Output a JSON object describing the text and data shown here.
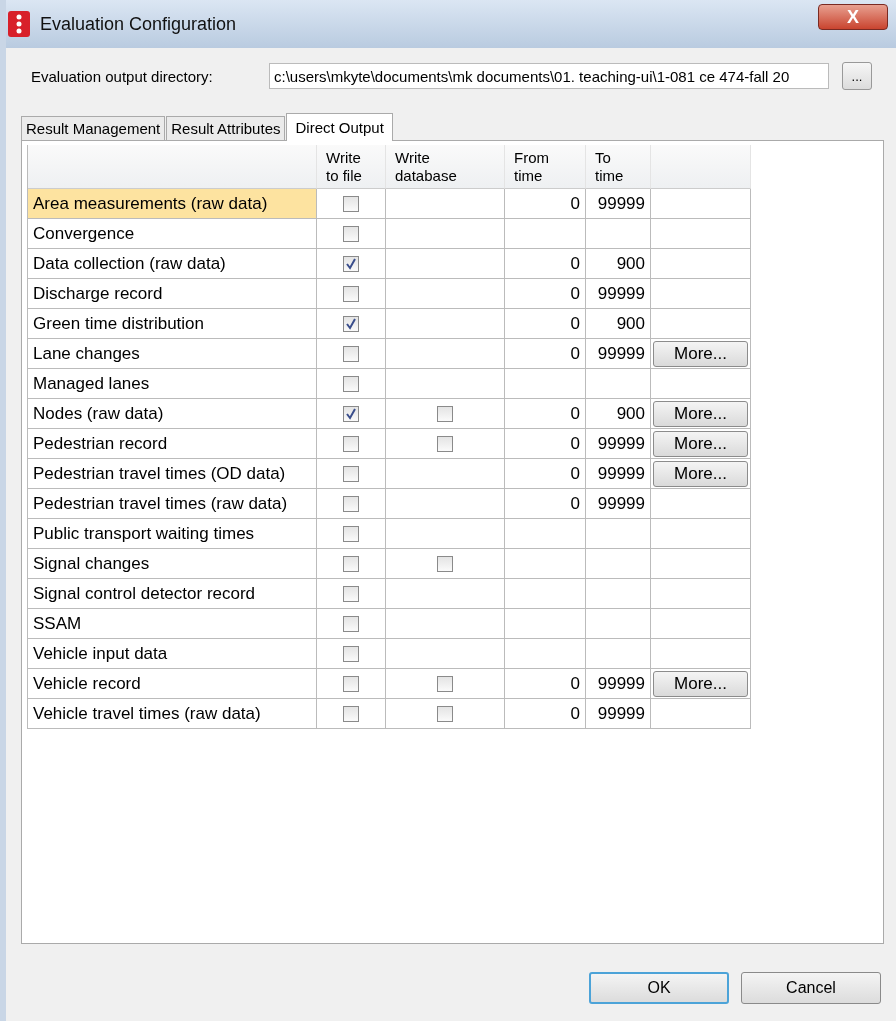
{
  "window": {
    "title": "Evaluation Configuration",
    "close": "X"
  },
  "output_directory": {
    "label": "Evaluation output directory:",
    "value": "c:\\users\\mkyte\\documents\\mk documents\\01. teaching-ui\\1-081 ce 474-fall 20",
    "browse": "..."
  },
  "tabs": [
    {
      "label": "Result Management",
      "selected": false
    },
    {
      "label": "Result Attributes",
      "selected": false
    },
    {
      "label": "Direct Output",
      "selected": true
    }
  ],
  "table": {
    "columns": [
      "",
      "Write to file",
      "Write database",
      "From time",
      "To time",
      ""
    ],
    "rows": [
      {
        "name": "Area measurements (raw data)",
        "selected": true,
        "write_file": false,
        "from": "0",
        "to": "99999"
      },
      {
        "name": "Convergence",
        "selected": false,
        "write_file": false
      },
      {
        "name": "Data collection (raw data)",
        "selected": false,
        "write_file": true,
        "from": "0",
        "to": "900"
      },
      {
        "name": "Discharge record",
        "selected": false,
        "write_file": false,
        "from": "0",
        "to": "99999"
      },
      {
        "name": "Green time distribution",
        "selected": false,
        "write_file": true,
        "from": "0",
        "to": "900"
      },
      {
        "name": "Lane changes",
        "selected": false,
        "write_file": false,
        "from": "0",
        "to": "99999",
        "more": "More..."
      },
      {
        "name": "Managed lanes",
        "selected": false,
        "write_file": false
      },
      {
        "name": "Nodes (raw data)",
        "selected": false,
        "write_file": true,
        "write_database": false,
        "from": "0",
        "to": "900",
        "more": "More..."
      },
      {
        "name": "Pedestrian record",
        "selected": false,
        "write_file": false,
        "write_database": false,
        "from": "0",
        "to": "99999",
        "more": "More..."
      },
      {
        "name": "Pedestrian travel times (OD data)",
        "selected": false,
        "write_file": false,
        "from": "0",
        "to": "99999",
        "more": "More..."
      },
      {
        "name": "Pedestrian travel times (raw data)",
        "selected": false,
        "write_file": false,
        "from": "0",
        "to": "99999"
      },
      {
        "name": "Public transport waiting times",
        "selected": false,
        "write_file": false
      },
      {
        "name": "Signal changes",
        "selected": false,
        "write_file": false,
        "write_database": false
      },
      {
        "name": "Signal control detector record",
        "selected": false,
        "write_file": false
      },
      {
        "name": "SSAM",
        "selected": false,
        "write_file": false
      },
      {
        "name": "Vehicle input data",
        "selected": false,
        "write_file": false
      },
      {
        "name": "Vehicle record",
        "selected": false,
        "write_file": false,
        "write_database": false,
        "from": "0",
        "to": "99999",
        "more": "More..."
      },
      {
        "name": "Vehicle travel times (raw data)",
        "selected": false,
        "write_file": false,
        "write_database": false,
        "from": "0",
        "to": "99999"
      }
    ]
  },
  "buttons": [
    {
      "label": "OK",
      "kind": "default"
    },
    {
      "label": "Cancel",
      "kind": "normal"
    }
  ]
}
